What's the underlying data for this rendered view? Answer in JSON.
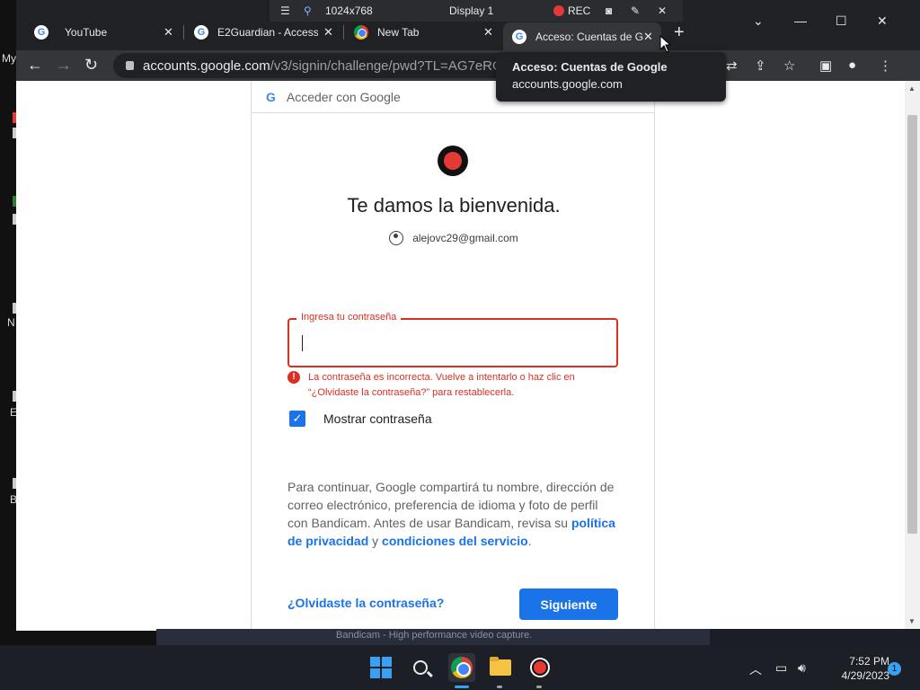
{
  "desktop": {
    "labels": [
      "My",
      "N",
      "E",
      "B"
    ]
  },
  "capture_bar": {
    "resolution": "1024x768",
    "display": "Display 1",
    "rec_label": "REC"
  },
  "tabs": [
    {
      "title": "YouTube",
      "favicon": "google-icon"
    },
    {
      "title": "E2Guardian - Access",
      "favicon": "google-icon"
    },
    {
      "title": "New Tab",
      "favicon": "chrome-icon"
    },
    {
      "title": "Acceso: Cuentas de G",
      "favicon": "google-icon",
      "active": true
    }
  ],
  "address_bar": {
    "host": "accounts.google.com",
    "path": "/v3/signin/challenge/pwd?TL=AG7eRGDt7"
  },
  "tooltip": {
    "title": "Acceso: Cuentas de Google",
    "url": "accounts.google.com"
  },
  "signin": {
    "header": "Acceder con Google",
    "welcome": "Te damos la bienvenida.",
    "email": "alejovc29@gmail.com",
    "password_label": "Ingresa tu contraseña",
    "password_value": "",
    "error": "La contraseña es incorrecta. Vuelve a intentarlo o haz clic en “¿Olvidaste la contraseña?” para restablecerla.",
    "show_password_label": "Mostrar contraseña",
    "show_password_checked": true,
    "consent_text": "Para continuar, Google compartirá tu nombre, dirección de correo electrónico, preferencia de idioma y foto de perfil con Bandicam. Antes de usar Bandicam, revisa su",
    "privacy_link": "política de privacidad",
    "and_word": "y",
    "terms_link": "condiciones del servicio",
    "period": ".",
    "forgot_link": "¿Olvidaste la contraseña?",
    "next_button": "Siguiente"
  },
  "banner": {
    "text": "Bandicam - High performance video capture."
  },
  "taskbar": {
    "time": "7:52 PM",
    "date": "4/29/2023",
    "notification_count": "1"
  },
  "colors": {
    "accent_blue": "#1a73e8",
    "error_red": "#d93025",
    "rec_red": "#e53935"
  }
}
